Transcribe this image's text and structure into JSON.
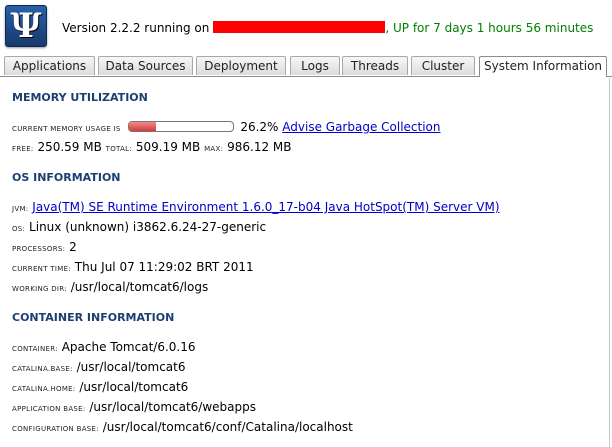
{
  "header": {
    "logo_glyph": "Ψ",
    "version_text": "Version 2.2.2 running on",
    "uptime_text": ", UP for 7 days 1 hours 56 minutes"
  },
  "tabs": [
    {
      "label": "Applications",
      "active": false
    },
    {
      "label": "Data Sources",
      "active": false
    },
    {
      "label": "Deployment",
      "active": false
    },
    {
      "label": "Logs",
      "active": false
    },
    {
      "label": "Threads",
      "active": false
    },
    {
      "label": "Cluster",
      "active": false
    },
    {
      "label": "System Information",
      "active": true
    }
  ],
  "memory": {
    "title": "MEMORY UTILIZATION",
    "usage_label": "CURRENT MEMORY USAGE IS",
    "usage_percent": 26.2,
    "usage_percent_text": "26.2%",
    "gc_link": "Advise Garbage Collection",
    "free_label": "FREE:",
    "free_value": "250.59 MB",
    "total_label": "TOTAL:",
    "total_value": "509.19 MB",
    "max_label": "MAX:",
    "max_value": "986.12 MB"
  },
  "os": {
    "title": "OS INFORMATION",
    "jvm_label": "JVM:",
    "jvm_value": " Java(TM) SE Runtime Environment  1.6.0_17-b04  Java HotSpot(TM) Server VM) ",
    "os_label": "OS:",
    "os_value": "Linux (unknown) i3862.6.24-27-generic",
    "processors_label": "PROCESSORS:",
    "processors_value": "2",
    "time_label": "CURRENT TIME:",
    "time_value": "Thu Jul 07 11:29:02 BRT 2011",
    "workdir_label": "WORKING DIR:",
    "workdir_value": "/usr/local/tomcat6/logs"
  },
  "container": {
    "title": "CONTAINER INFORMATION",
    "container_label": "CONTAINER:",
    "container_value": "Apache Tomcat/6.0.16",
    "base_label": "CATALINA.BASE:",
    "base_value": "/usr/local/tomcat6",
    "home_label": "CATALINA.HOME:",
    "home_value": "/usr/local/tomcat6",
    "appbase_label": "APPLICATION BASE:",
    "appbase_value": "/usr/local/tomcat6/webapps",
    "confbase_label": "CONFIGURATION BASE:",
    "confbase_value": "/usr/local/tomcat6/conf/Catalina/localhost"
  }
}
